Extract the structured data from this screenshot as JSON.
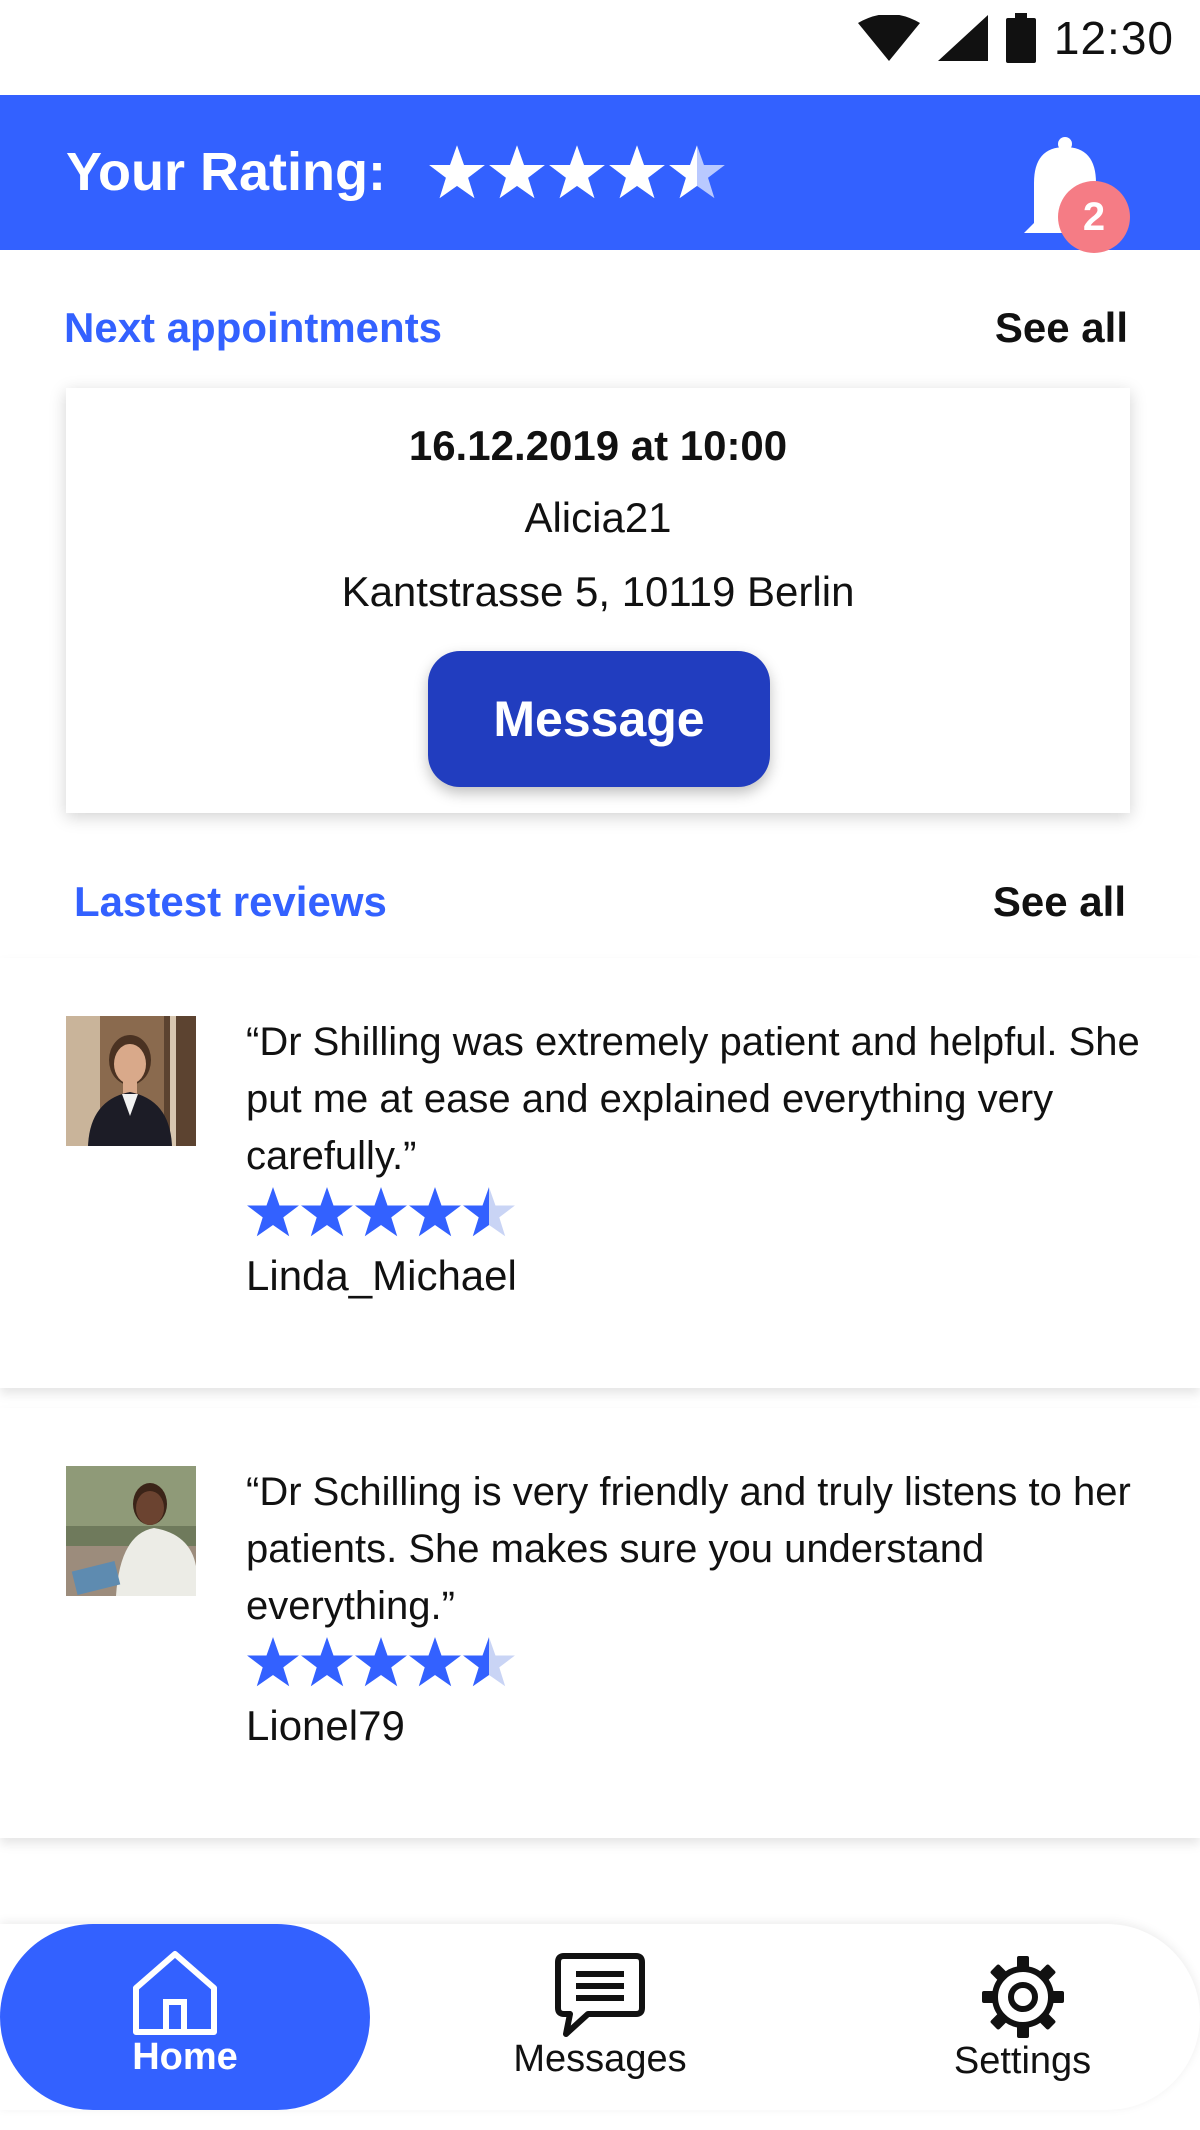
{
  "status_bar": {
    "time": "12:30",
    "icons": [
      "wifi-icon",
      "signal-icon",
      "battery-icon"
    ]
  },
  "header": {
    "rating_label": "Your Rating:",
    "rating_value": 4.5,
    "rating_max": 5,
    "notification_count": "2",
    "colors": {
      "background": "#3361FF",
      "badge": "#F57C85"
    }
  },
  "appointments": {
    "title": "Next appointments",
    "see_all": "See all",
    "next": {
      "datetime": "16.12.2019 at 10:00",
      "user": "Alicia21",
      "address": "Kantstrasse 5, 10119 Berlin",
      "button_label": "Message"
    }
  },
  "reviews": {
    "title": "Lastest reviews",
    "see_all": "See all",
    "items": [
      {
        "text": "“Dr Shilling was extremely patient and helpful. She put me at ease and explained everything very carefully.”",
        "rating": 4.5,
        "author": "Linda_Michael"
      },
      {
        "text": "“Dr Schilling is very friendly and truly listens to her patients. She makes sure you understand  everything.”",
        "rating": 4.5,
        "author": "Lionel79"
      }
    ]
  },
  "nav": {
    "home": "Home",
    "messages": "Messages",
    "settings": "Settings",
    "active": "home"
  },
  "colors": {
    "accent": "#3361FF",
    "button": "#213DBF"
  }
}
